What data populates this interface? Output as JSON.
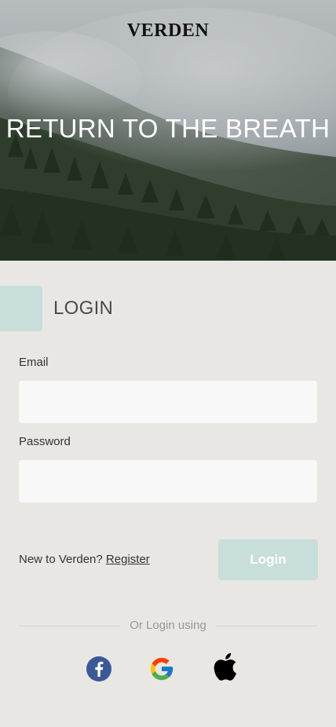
{
  "header": {
    "brand": "VERDEN",
    "tagline": "RETURN TO THE BREATH"
  },
  "login": {
    "title": "LOGIN",
    "email_label": "Email",
    "email_value": "",
    "password_label": "Password",
    "password_value": "",
    "register_prompt": "New to Verden?",
    "register_link": "Register",
    "login_button": "Login",
    "alt_login_text": "Or Login using"
  },
  "social": [
    {
      "name": "facebook",
      "icon": "facebook-icon",
      "color": "#3b5998"
    },
    {
      "name": "google",
      "icon": "google-icon"
    },
    {
      "name": "apple",
      "icon": "apple-icon",
      "color": "#000000"
    }
  ],
  "colors": {
    "background": "#e9e7e3",
    "accent": "#c8dedb",
    "input_background": "#f8f8f8"
  }
}
